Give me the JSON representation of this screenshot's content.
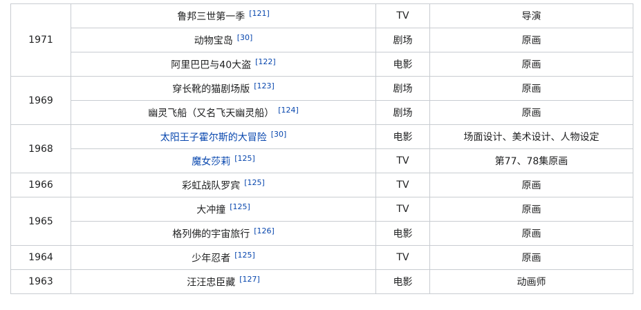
{
  "rows": [
    {
      "year": "1971",
      "rowspan": 3,
      "title": "鲁邦三世第一季",
      "ref": "[121]",
      "type": "TV",
      "role": "导演",
      "link": false
    },
    {
      "title": "动物宝岛",
      "ref": "[30]",
      "type": "剧场",
      "role": "原画",
      "link": false
    },
    {
      "title": "阿里巴巴与40大盗",
      "ref": "[122]",
      "type": "电影",
      "role": "原画",
      "link": false
    },
    {
      "year": "1969",
      "rowspan": 2,
      "title": "穿长靴的猫剧场版",
      "ref": "[123]",
      "type": "剧场",
      "role": "原画",
      "link": false
    },
    {
      "title": "幽灵飞船（又名飞天幽灵船）",
      "ref": "[124]",
      "type": "剧场",
      "role": "原画",
      "link": false
    },
    {
      "year": "1968",
      "rowspan": 2,
      "title": "太阳王子霍尔斯的大冒险",
      "ref": "[30]",
      "type": "电影",
      "role": "场面设计、美术设计、人物设定",
      "link": true
    },
    {
      "title": "魔女莎莉",
      "ref": "[125]",
      "type": "TV",
      "role": "第77、78集原画",
      "link": true
    },
    {
      "year": "1966",
      "rowspan": 1,
      "title": "彩虹战队罗宾",
      "ref": "[125]",
      "type": "TV",
      "role": "原画",
      "link": false
    },
    {
      "year": "1965",
      "rowspan": 2,
      "title": "大冲撞",
      "ref": "[125]",
      "type": "TV",
      "role": "原画",
      "link": false
    },
    {
      "title": "格列佛的宇宙旅行",
      "ref": "[126]",
      "type": "电影",
      "role": "原画",
      "link": false
    },
    {
      "year": "1964",
      "rowspan": 1,
      "title": "少年忍者",
      "ref": "[125]",
      "type": "TV",
      "role": "原画",
      "link": false
    },
    {
      "year": "1963",
      "rowspan": 1,
      "title": "汪汪忠臣藏",
      "ref": "[127]",
      "type": "电影",
      "role": "动画师",
      "link": false
    }
  ]
}
